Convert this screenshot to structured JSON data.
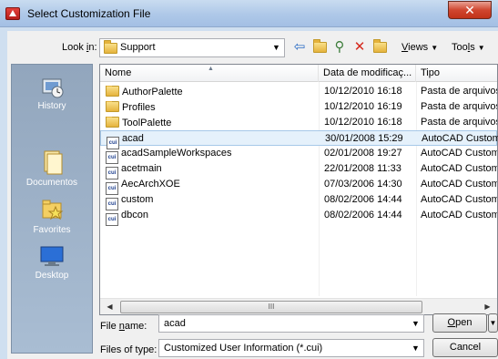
{
  "window": {
    "title": "Select Customization File",
    "close_glyph": "✕"
  },
  "toolbar": {
    "look_in_label_pre": "Look ",
    "look_in_label_key": "i",
    "look_in_label_post": "n:",
    "look_in_value": "Support",
    "views_key": "V",
    "views_rest": "iews",
    "tools_pre": "Too",
    "tools_key": "l",
    "tools_post": "s",
    "icons": [
      "back-arrow-icon",
      "up-folder-icon",
      "search-icon",
      "delete-icon",
      "new-folder-icon"
    ]
  },
  "places": [
    {
      "label": "History",
      "icon": "history-icon"
    },
    {
      "label": "Documentos",
      "icon": "documents-icon"
    },
    {
      "label": "Favorites",
      "icon": "favorites-icon"
    },
    {
      "label": "Desktop",
      "icon": "desktop-icon"
    }
  ],
  "columns": {
    "name": "Nome",
    "date": "Data de modificaç...",
    "type": "Tipo"
  },
  "files": [
    {
      "name": "AuthorPalette",
      "date": "10/12/2010 16:18",
      "type": "Pasta de arquivos",
      "kind": "folder"
    },
    {
      "name": "Profiles",
      "date": "10/12/2010 16:19",
      "type": "Pasta de arquivos",
      "kind": "folder"
    },
    {
      "name": "ToolPalette",
      "date": "10/12/2010 16:18",
      "type": "Pasta de arquivos",
      "kind": "folder"
    },
    {
      "name": "acad",
      "date": "30/01/2008 15:29",
      "type": "AutoCAD Custom",
      "kind": "cui",
      "selected": true
    },
    {
      "name": "acadSampleWorkspaces",
      "date": "02/01/2008 19:27",
      "type": "AutoCAD Custom",
      "kind": "cui"
    },
    {
      "name": "acetmain",
      "date": "22/01/2008 11:33",
      "type": "AutoCAD Custom",
      "kind": "cui"
    },
    {
      "name": "AecArchXOE",
      "date": "07/03/2006 14:30",
      "type": "AutoCAD Custom",
      "kind": "cui"
    },
    {
      "name": "custom",
      "date": "08/02/2006 14:44",
      "type": "AutoCAD Custom",
      "kind": "cui"
    },
    {
      "name": "dbcon",
      "date": "08/02/2006 14:44",
      "type": "AutoCAD Custom",
      "kind": "cui"
    }
  ],
  "scrollbar": {
    "thumb_grip": "III",
    "left": "◀",
    "right": "▶"
  },
  "bottom": {
    "file_name_label_pre": "File ",
    "file_name_label_key": "n",
    "file_name_label_post": "ame:",
    "file_name_value": "acad",
    "files_of_type_label": "Files of type:",
    "files_of_type_value": "Customized User Information (*.cui)",
    "open_key": "O",
    "open_rest": "pen",
    "cancel_label": "Cancel"
  }
}
